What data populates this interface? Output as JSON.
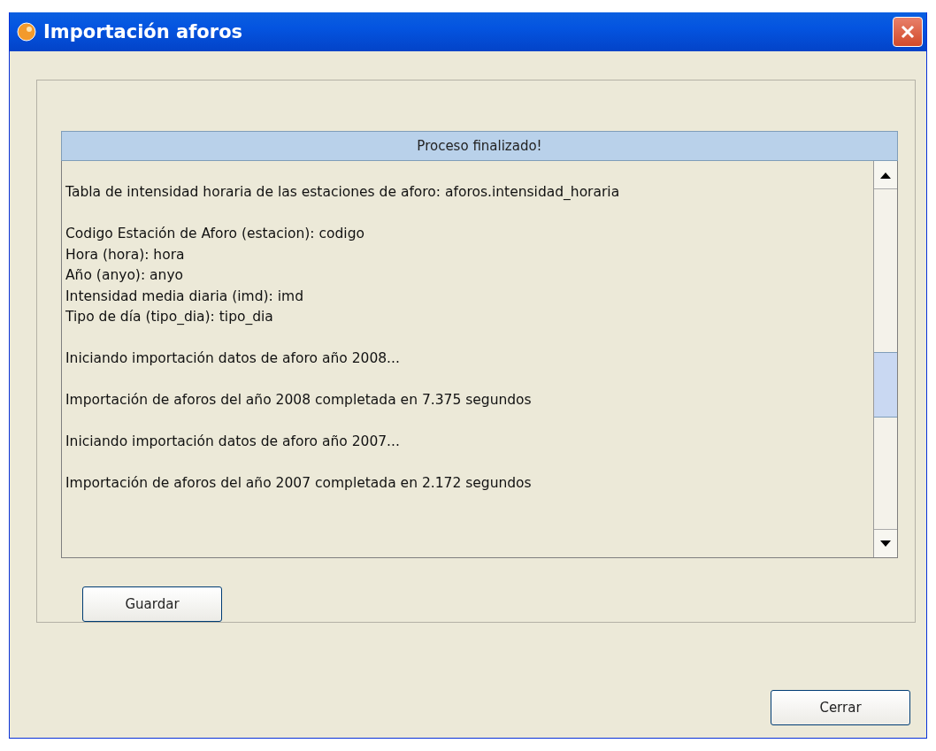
{
  "window": {
    "title": "Importación aforos"
  },
  "progress": {
    "text": "Proceso finalizado!",
    "level": 1
  },
  "log": [
    [
      "Tabla de intensidad horaria de las estaciones de aforo: aforos.intensidad_horaria"
    ],
    [
      "Codigo Estación de Aforo (estacion): codigo",
      "Hora (hora): hora",
      "Año (anyo): anyo",
      "Intensidad media diaria (imd): imd",
      "Tipo de día (tipo_dia): tipo_dia"
    ],
    [
      "Iniciando importación datos de aforo año 2008..."
    ],
    [
      "Importación de aforos del año 2008 completada en 7.375 segundos"
    ],
    [
      "Iniciando importación datos de aforo año 2007..."
    ],
    [
      "Importación de aforos del año 2007 completada en 2.172 segundos"
    ]
  ],
  "buttons": {
    "save": "Guardar",
    "close": "Cerrar"
  }
}
